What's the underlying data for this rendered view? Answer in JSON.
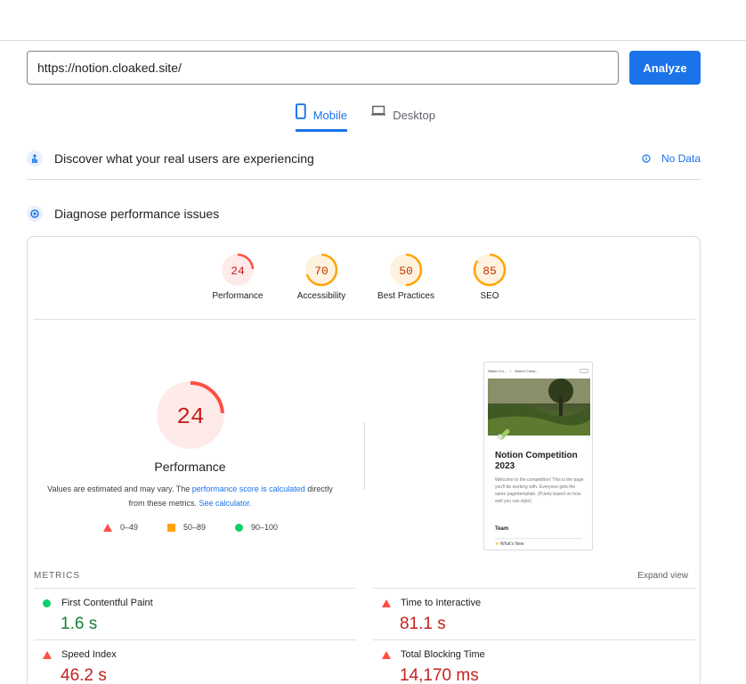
{
  "url_input": {
    "value": "https://notion.cloaked.site/"
  },
  "analyze_label": "Analyze",
  "tabs": [
    {
      "label": "Mobile"
    },
    {
      "label": "Desktop"
    }
  ],
  "field_data": {
    "title": "Discover what your real users are experiencing",
    "no_data": "No Data"
  },
  "diagnose": {
    "title": "Diagnose performance issues"
  },
  "scores": [
    {
      "label": "Performance",
      "score": 24
    },
    {
      "label": "Accessibility",
      "score": 70
    },
    {
      "label": "Best Practices",
      "score": 50
    },
    {
      "label": "SEO",
      "score": 85
    }
  ],
  "big_score": {
    "label": "Performance",
    "score": 24
  },
  "estimate": {
    "text1": "Values are estimated and may vary. The ",
    "link1": "performance score is calculated",
    "text2": " directly from these metrics. ",
    "link2": "See calculator."
  },
  "legend": [
    {
      "range": "0–49"
    },
    {
      "range": "50–89"
    },
    {
      "range": "90–100"
    }
  ],
  "screenshot": {
    "crumb1": "Notion Co...",
    "crumb_sep": "/",
    "crumb2": "Notion Comp...",
    "title": "Notion Competition 2023",
    "desc": "Welcome to the competition! This is the page you'll be working with. Everyone gets the same page/template. (Purely based on how well you can style)",
    "team": "Team",
    "news": "What's New"
  },
  "metrics_label": "METRICS",
  "expand_label": "Expand view",
  "metrics": [
    {
      "name": "First Contentful Paint",
      "value": "1.6 s"
    },
    {
      "name": "Time to Interactive",
      "value": "81.1 s"
    },
    {
      "name": "Speed Index",
      "value": "46.2 s"
    },
    {
      "name": "Total Blocking Time",
      "value": "14,170 ms"
    }
  ],
  "colors": {
    "accent": "#1a73e8",
    "fail": "#ff4e42",
    "average": "#ffa400",
    "pass": "#0cce6b",
    "fail_text": "#c5221f",
    "pass_text": "#188038"
  }
}
